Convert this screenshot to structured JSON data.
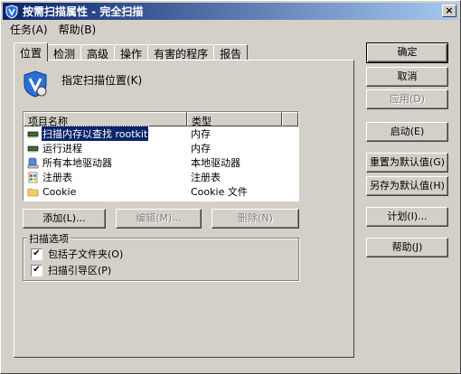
{
  "window": {
    "title": "按需扫描属性 - 完全扫描",
    "close_glyph": "×"
  },
  "menu": [
    "任务(A)",
    "帮助(B)"
  ],
  "tabs": [
    "位置",
    "检测",
    "高级",
    "操作",
    "有害的程序",
    "报告"
  ],
  "location_label": "指定扫描位置(K)",
  "list": {
    "headers": [
      "项目名称",
      "类型"
    ],
    "rows": [
      {
        "name": "扫描内存以查找 rootkit",
        "type": "内存",
        "icon": "memory-chip-icon",
        "selected": true
      },
      {
        "name": "运行进程",
        "type": "内存",
        "icon": "memory-chip-icon",
        "selected": false
      },
      {
        "name": "所有本地驱动器",
        "type": "本地驱动器",
        "icon": "drive-icon",
        "selected": false
      },
      {
        "name": "注册表",
        "type": "注册表",
        "icon": "registry-icon",
        "selected": false
      },
      {
        "name": "Cookie",
        "type": "Cookie 文件",
        "icon": "folder-icon",
        "selected": false
      }
    ]
  },
  "list_buttons": {
    "add": "添加(L)...",
    "edit": "编辑(M)...",
    "remove": "删除(N)"
  },
  "scan_options": {
    "title": "扫描选项",
    "include_subfolders": "包括子文件夹(O)",
    "scan_boot_sector": "扫描引导区(P)",
    "checked_glyph": "✔"
  },
  "side_buttons": {
    "ok": "确定",
    "cancel": "取消",
    "apply": "应用(D)",
    "start": "启动(E)",
    "reset_default": "重置为默认值(G)",
    "save_default": "另存为默认值(H)",
    "schedule": "计划(I)...",
    "help": "帮助(J)"
  }
}
